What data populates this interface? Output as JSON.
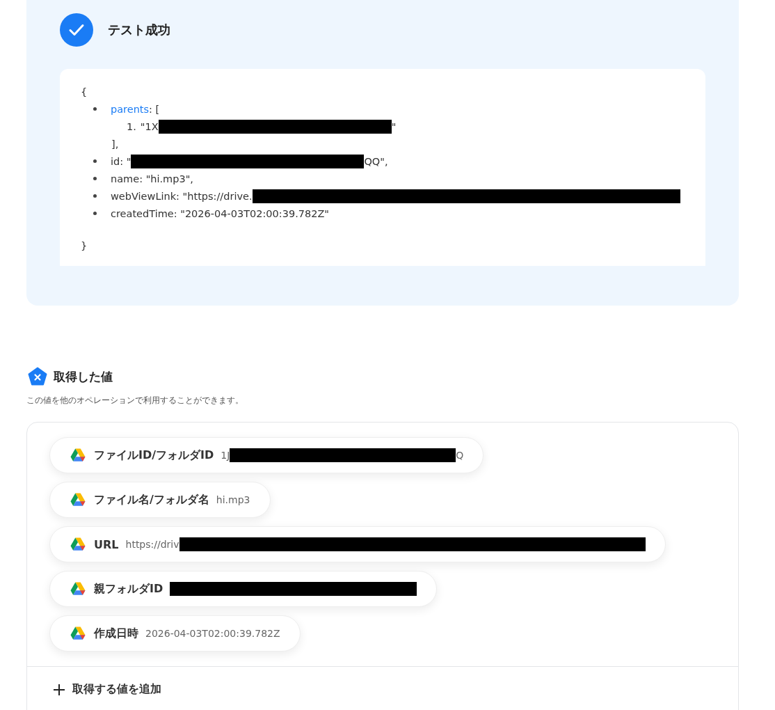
{
  "result": {
    "kind": "success",
    "title": "テスト成功",
    "json": {
      "open": "{",
      "close": "}",
      "items": [
        {
          "key": "parents",
          "link": true,
          "sep": ": [",
          "children": [
            {
              "number": "1.",
              "parts": [
                {
                  "text": "\"1X"
                },
                {
                  "redacted": true
                },
                {
                  "text": "\""
                }
              ]
            }
          ],
          "end": "],"
        },
        {
          "key": "id",
          "link": false,
          "sep": ": \"",
          "parts": [
            {
              "redacted": true
            },
            {
              "text": "QQ\","
            }
          ]
        },
        {
          "key": "name",
          "link": false,
          "sep": ": ",
          "parts": [
            {
              "text": "\"hi.mp3\","
            }
          ]
        },
        {
          "key": "webViewLink",
          "link": false,
          "sep": ": ",
          "parts": [
            {
              "text": "\"https://drive."
            },
            {
              "redacted": true
            }
          ]
        },
        {
          "key": "createdTime",
          "link": false,
          "sep": ": ",
          "parts": [
            {
              "text": "\"2026-04-03T02:00:39.782Z\""
            }
          ]
        }
      ]
    }
  },
  "values": {
    "title": "取得した値",
    "description": "この値を他のオペレーションで利用することができます。",
    "fields": [
      {
        "label": "ファイルID/フォルダID",
        "parts": [
          {
            "text": "1J"
          },
          {
            "redacted": true
          },
          {
            "text": "Q"
          }
        ]
      },
      {
        "label": "ファイル名/フォルダ名",
        "parts": [
          {
            "text": "hi.mp3"
          }
        ]
      },
      {
        "label": "URL",
        "parts": [
          {
            "text": "https://driv"
          },
          {
            "redacted": true
          }
        ]
      },
      {
        "label": "親フォルダID",
        "parts": [
          {
            "redacted": true
          }
        ]
      },
      {
        "label": "作成日時",
        "parts": [
          {
            "text": "2026-04-03T02:00:39.782Z"
          }
        ]
      }
    ],
    "add_button": "取得する値を追加"
  }
}
